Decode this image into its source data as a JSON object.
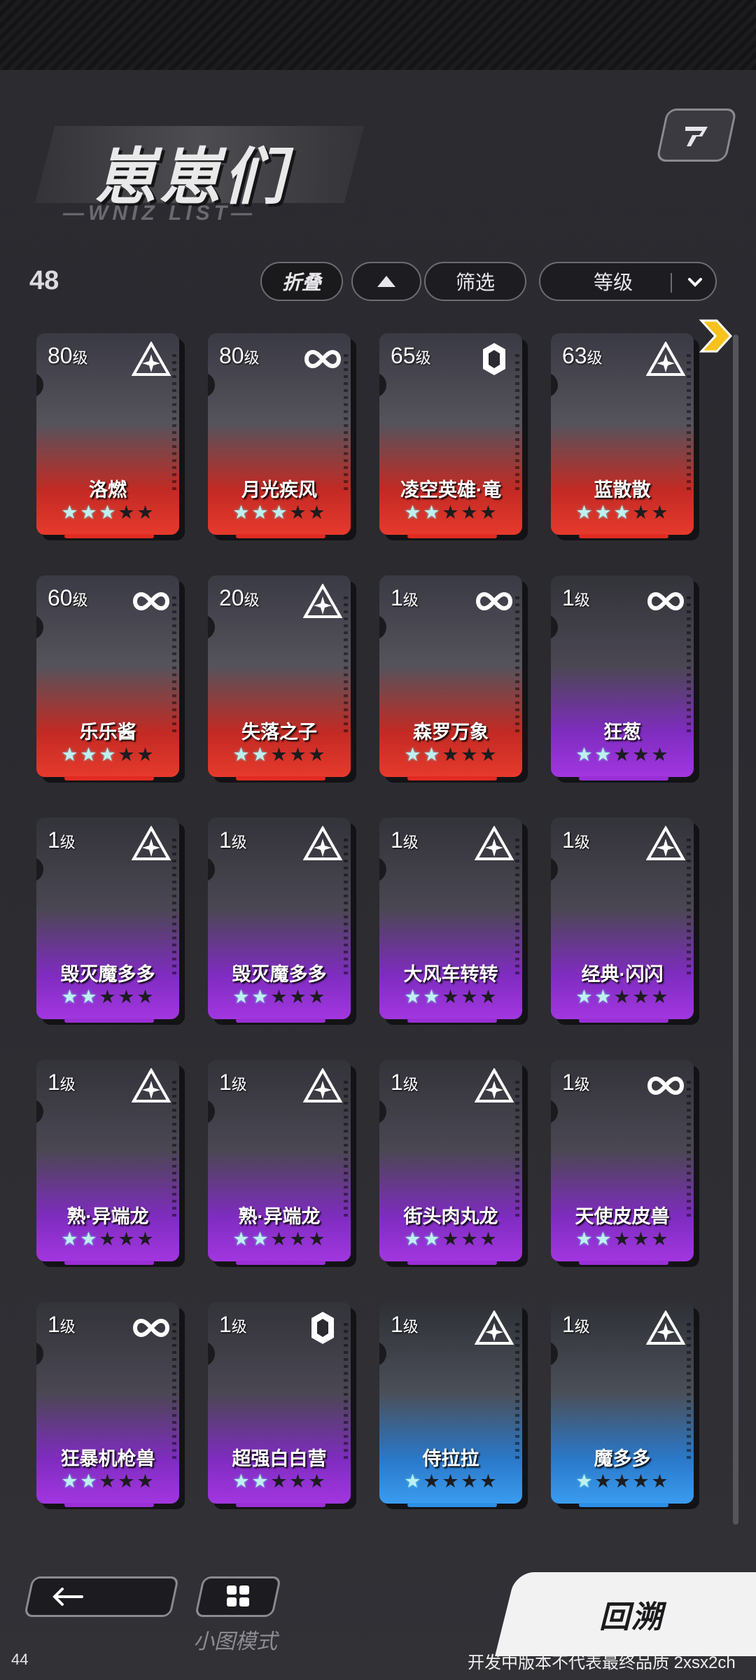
{
  "header": {
    "title": "崽崽们",
    "subtitle": "—WNIZ LIST—",
    "count": "48"
  },
  "controls": {
    "fold_label": "折叠",
    "filter_label": "筛选",
    "sort_label": "等级"
  },
  "cards": [
    {
      "level": "80",
      "unit": "级",
      "name": "洛燃",
      "type": "triangle-icon",
      "rarity": "red",
      "stars": 3
    },
    {
      "level": "80",
      "unit": "级",
      "name": "月光疾风",
      "type": "infinity-icon",
      "rarity": "red",
      "stars": 3
    },
    {
      "level": "65",
      "unit": "级",
      "name": "凌空英雄·竜",
      "type": "hexagon-icon",
      "rarity": "red",
      "stars": 2
    },
    {
      "level": "63",
      "unit": "级",
      "name": "蓝散散",
      "type": "triangle-icon",
      "rarity": "red",
      "stars": 3
    },
    {
      "level": "60",
      "unit": "级",
      "name": "乐乐酱",
      "type": "infinity-icon",
      "rarity": "red",
      "stars": 3
    },
    {
      "level": "20",
      "unit": "级",
      "name": "失落之子",
      "type": "triangle-icon",
      "rarity": "red",
      "stars": 2
    },
    {
      "level": "1",
      "unit": "级",
      "name": "森罗万象",
      "type": "infinity-icon",
      "rarity": "red",
      "stars": 2
    },
    {
      "level": "1",
      "unit": "级",
      "name": "狂葱",
      "type": "infinity-icon",
      "rarity": "purple",
      "stars": 2
    },
    {
      "level": "1",
      "unit": "级",
      "name": "毁灭魔多多",
      "type": "triangle-icon",
      "rarity": "purple",
      "stars": 2
    },
    {
      "level": "1",
      "unit": "级",
      "name": "毁灭魔多多",
      "type": "triangle-icon",
      "rarity": "purple",
      "stars": 2
    },
    {
      "level": "1",
      "unit": "级",
      "name": "大风车转转",
      "type": "triangle-icon",
      "rarity": "purple",
      "stars": 2
    },
    {
      "level": "1",
      "unit": "级",
      "name": "经典·闪闪",
      "type": "triangle-icon",
      "rarity": "purple",
      "stars": 2
    },
    {
      "level": "1",
      "unit": "级",
      "name": "熟·异端龙",
      "type": "triangle-icon",
      "rarity": "purple",
      "stars": 2
    },
    {
      "level": "1",
      "unit": "级",
      "name": "熟·异端龙",
      "type": "triangle-icon",
      "rarity": "purple",
      "stars": 2
    },
    {
      "level": "1",
      "unit": "级",
      "name": "街头肉丸龙",
      "type": "triangle-icon",
      "rarity": "purple",
      "stars": 2
    },
    {
      "level": "1",
      "unit": "级",
      "name": "天使皮皮兽",
      "type": "infinity-icon",
      "rarity": "purple",
      "stars": 2
    },
    {
      "level": "1",
      "unit": "级",
      "name": "狂暴机枪兽",
      "type": "infinity-icon",
      "rarity": "purple",
      "stars": 2
    },
    {
      "level": "1",
      "unit": "级",
      "name": "超强白白营",
      "type": "hexagon-icon",
      "rarity": "purple",
      "stars": 2
    },
    {
      "level": "1",
      "unit": "级",
      "name": "侍拉拉",
      "type": "triangle-icon",
      "rarity": "blue",
      "stars": 1
    },
    {
      "level": "1",
      "unit": "级",
      "name": "魔多多",
      "type": "triangle-icon",
      "rarity": "blue",
      "stars": 1
    }
  ],
  "colors": {
    "red": "#e12a22",
    "purple": "#9a2fd6",
    "blue": "#2c8fe6"
  },
  "footer": {
    "small_mode_label": "小图模式",
    "recall_label": "回溯",
    "version_note": "开发中版本不代表最终品质 2xsx2ch",
    "fps": "44"
  }
}
